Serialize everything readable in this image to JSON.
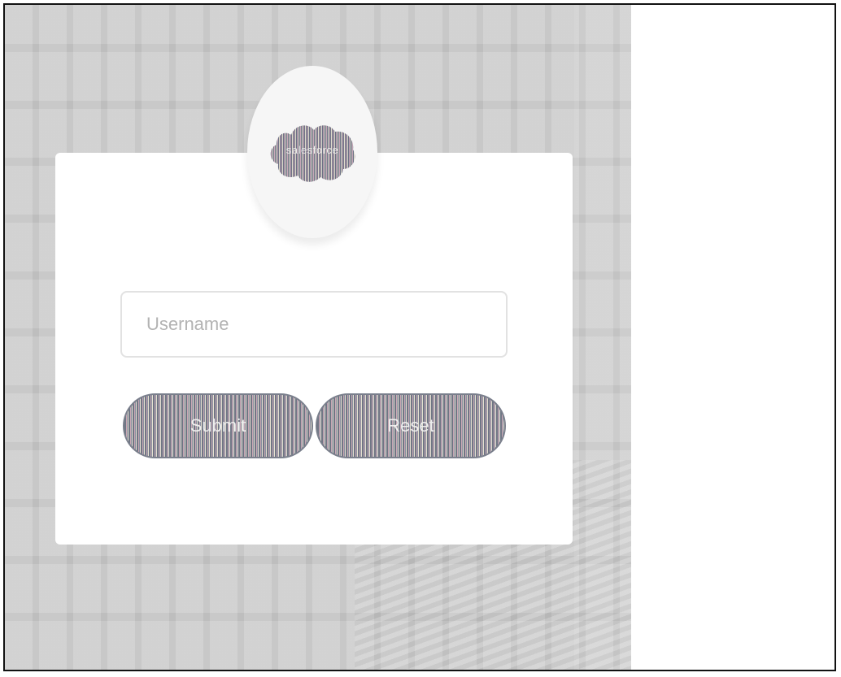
{
  "logo": {
    "text": "salesforce",
    "icon": "salesforce-cloud-logo"
  },
  "form": {
    "username_placeholder": "Username",
    "username_value": "",
    "submit_label": "Submit",
    "reset_label": "Reset"
  },
  "colors": {
    "background": "#cdcdcd",
    "card": "#ffffff",
    "button": "#7a7f8c"
  }
}
